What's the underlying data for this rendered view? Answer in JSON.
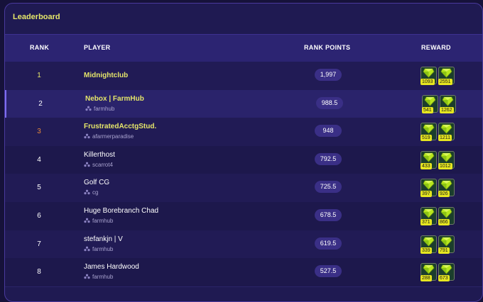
{
  "title": "Leaderboard",
  "columns": {
    "rank": "RANK",
    "player": "PLAYER",
    "points": "RANK POINTS",
    "reward": "REWARD"
  },
  "colors": {
    "gold": "#e5e66a",
    "bronze": "#e88a3c",
    "accent": "#7d6df0",
    "reward_badge": "#e6e620"
  },
  "rows": [
    {
      "rank": "1",
      "name": "Midnightclub",
      "club": "",
      "points": "1,997",
      "rewards": [
        "1093",
        "2551"
      ]
    },
    {
      "rank": "2",
      "name": "Nebox | FarmHub",
      "club": "farmhub",
      "points": "988.5",
      "rewards": [
        "541",
        "1262"
      ]
    },
    {
      "rank": "3",
      "name": "FrustratedAcctgStud.",
      "club": "afarmerparadise",
      "points": "948",
      "rewards": [
        "519",
        "1211"
      ]
    },
    {
      "rank": "4",
      "name": "Killerthost",
      "club": "scarrot4",
      "points": "792.5",
      "rewards": [
        "433",
        "1012"
      ]
    },
    {
      "rank": "5",
      "name": "Golf CG",
      "club": "cg",
      "points": "725.5",
      "rewards": [
        "397",
        "926"
      ]
    },
    {
      "rank": "6",
      "name": "Huge Borebranch Chad",
      "club": "farmhub",
      "points": "678.5",
      "rewards": [
        "371",
        "866"
      ]
    },
    {
      "rank": "7",
      "name": "stefankjn | V",
      "club": "farmhub",
      "points": "619.5",
      "rewards": [
        "339",
        "791"
      ]
    },
    {
      "rank": "8",
      "name": "James Hardwood",
      "club": "farmhub",
      "points": "527.5",
      "rewards": [
        "288",
        "673"
      ]
    }
  ],
  "icons": {
    "reward": "gem-icon",
    "club": "club-icon"
  }
}
